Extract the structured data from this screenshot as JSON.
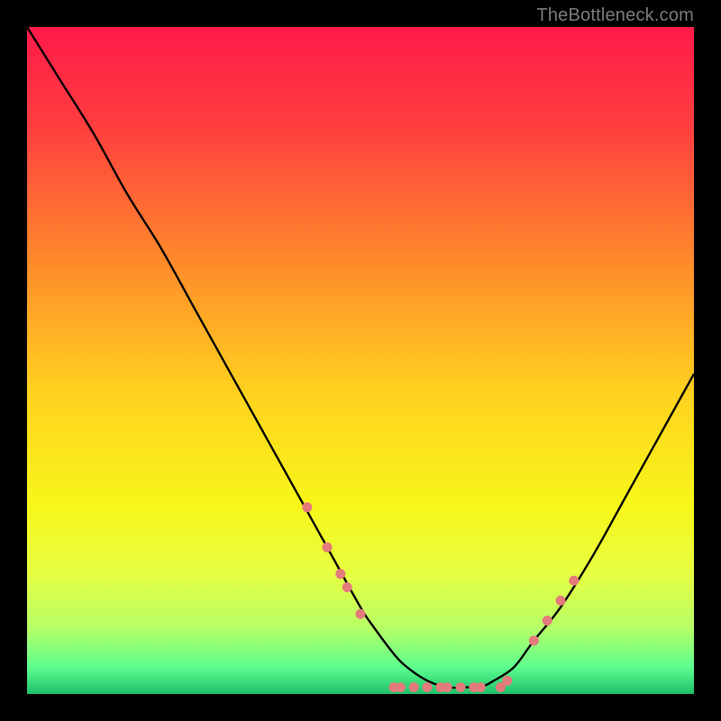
{
  "watermark": "TheBottleneck.com",
  "chart_data": {
    "type": "line",
    "title": "",
    "xlabel": "",
    "ylabel": "",
    "xlim": [
      0,
      100
    ],
    "ylim": [
      0,
      100
    ],
    "grid": false,
    "background_gradient": {
      "stops": [
        {
          "offset": 0.0,
          "color": "#ff1a49"
        },
        {
          "offset": 0.15,
          "color": "#ff3f3f"
        },
        {
          "offset": 0.35,
          "color": "#ff8a2b"
        },
        {
          "offset": 0.55,
          "color": "#ffd21e"
        },
        {
          "offset": 0.72,
          "color": "#f7f71a"
        },
        {
          "offset": 0.82,
          "color": "#e7ff42"
        },
        {
          "offset": 0.9,
          "color": "#b7ff66"
        },
        {
          "offset": 0.96,
          "color": "#5dff8f"
        },
        {
          "offset": 1.0,
          "color": "#1fbf6b"
        }
      ]
    },
    "series": [
      {
        "name": "curve",
        "color": "#000000",
        "x": [
          0,
          5,
          10,
          15,
          20,
          25,
          30,
          35,
          40,
          45,
          50,
          52,
          55,
          57,
          60,
          63,
          66,
          68,
          70,
          73,
          76,
          80,
          85,
          90,
          95,
          100
        ],
        "y": [
          100,
          92,
          84,
          75,
          67,
          58,
          49,
          40,
          31,
          22,
          13,
          10,
          6,
          4,
          2,
          1,
          1,
          1,
          2,
          4,
          8,
          13,
          21,
          30,
          39,
          48
        ]
      }
    ],
    "dots": {
      "color": "#e47b7b",
      "radius": 5.5,
      "points": [
        {
          "x": 42,
          "y": 28
        },
        {
          "x": 45,
          "y": 22
        },
        {
          "x": 47,
          "y": 18
        },
        {
          "x": 48,
          "y": 16
        },
        {
          "x": 50,
          "y": 12
        },
        {
          "x": 55,
          "y": 1
        },
        {
          "x": 56,
          "y": 1
        },
        {
          "x": 58,
          "y": 1
        },
        {
          "x": 60,
          "y": 1
        },
        {
          "x": 62,
          "y": 1
        },
        {
          "x": 63,
          "y": 1
        },
        {
          "x": 65,
          "y": 1
        },
        {
          "x": 67,
          "y": 1
        },
        {
          "x": 68,
          "y": 1
        },
        {
          "x": 71,
          "y": 1
        },
        {
          "x": 72,
          "y": 2
        },
        {
          "x": 76,
          "y": 8
        },
        {
          "x": 78,
          "y": 11
        },
        {
          "x": 80,
          "y": 14
        },
        {
          "x": 82,
          "y": 17
        }
      ]
    }
  }
}
